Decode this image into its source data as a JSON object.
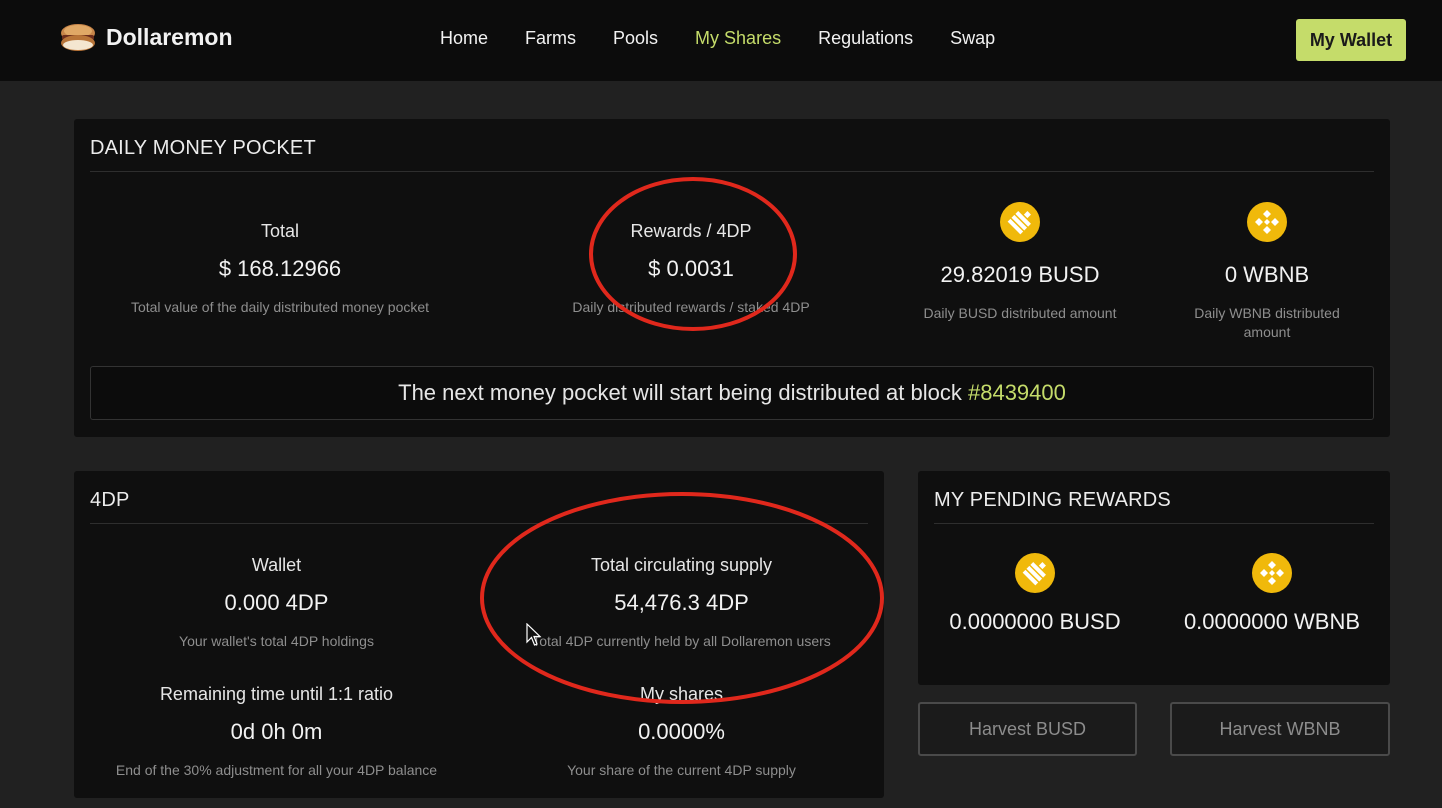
{
  "nav": {
    "brand": "Dollaremon",
    "links": [
      "Home",
      "Farms",
      "Pools",
      "My Shares",
      "Regulations",
      "Swap"
    ],
    "active": "My Shares",
    "wallet_button": "My Wallet"
  },
  "daily_pocket": {
    "title": "DAILY MONEY POCKET",
    "total": {
      "label": "Total",
      "value": "$ 168.12966",
      "desc": "Total value of the daily distributed money pocket"
    },
    "rewards": {
      "label": "Rewards / 4DP",
      "value": "$ 0.0031",
      "desc": "Daily distributed rewards / staked 4DP"
    },
    "busd": {
      "icon": "busd-coin-icon",
      "value": "29.82019 BUSD",
      "desc": "Daily BUSD distributed amount"
    },
    "wbnb": {
      "icon": "bnb-coin-icon",
      "value": "0 WBNB",
      "desc": "Daily WBNB distributed amount"
    },
    "next_block_text": "The next money pocket will start being distributed at block",
    "next_block_number": "#8439400"
  },
  "fourdp": {
    "title": "4DP",
    "wallet": {
      "label": "Wallet",
      "value": "0.000 4DP",
      "desc": "Your wallet's total 4DP holdings"
    },
    "supply": {
      "label": "Total circulating supply",
      "value": "54,476.3 4DP",
      "desc": "Total 4DP currently held by all Dollaremon users"
    },
    "remaining": {
      "label": "Remaining time until 1:1 ratio",
      "value": "0d 0h 0m",
      "desc": "End of the 30% adjustment for all your 4DP balance"
    },
    "shares": {
      "label": "My shares",
      "value": "0.0000%",
      "desc": "Your share of the current 4DP supply"
    }
  },
  "pending": {
    "title": "MY PENDING REWARDS",
    "busd_value": "0.0000000 BUSD",
    "wbnb_value": "0.0000000 WBNB",
    "harvest_busd": "Harvest BUSD",
    "harvest_wbnb": "Harvest WBNB"
  },
  "colors": {
    "accent": "#c5dc6a",
    "coin": "#f0b90b",
    "annotation": "#e0281c"
  }
}
